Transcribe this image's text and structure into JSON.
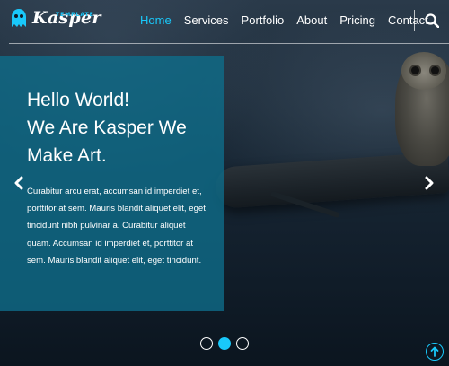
{
  "brand": {
    "name": "Kasper",
    "tag": "TEMPLATE"
  },
  "nav": {
    "items": [
      {
        "label": "Home",
        "active": true
      },
      {
        "label": "Services",
        "active": false
      },
      {
        "label": "Portfolio",
        "active": false
      },
      {
        "label": "About",
        "active": false
      },
      {
        "label": "Pricing",
        "active": false
      },
      {
        "label": "Contact",
        "active": false
      }
    ]
  },
  "hero": {
    "title_lines": [
      "Hello World!",
      "We Are Kasper We",
      "Make Art."
    ],
    "description": "Curabitur arcu erat, accumsan id imperdiet et, porttitor at sem. Mauris blandit aliquet elit, eget tincidunt nibh pulvinar a. Curabitur aliquet quam. Accumsan id imperdiet et, porttitor at sem. Mauris blandit aliquet elit, eget tincidunt."
  },
  "slider": {
    "slide_count": 3,
    "active_index": 1
  },
  "colors": {
    "accent": "#19c8fa",
    "panel": "#0e6e8c"
  },
  "icons": [
    "ghost-logo-icon",
    "search-icon",
    "arrow-left-icon",
    "arrow-right-icon",
    "arrow-up-icon"
  ]
}
